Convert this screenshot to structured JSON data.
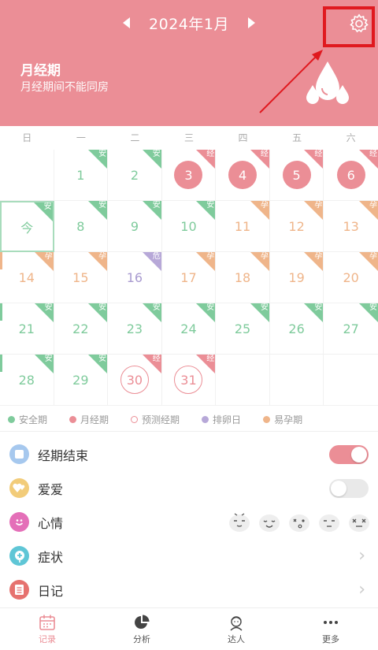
{
  "header": {
    "month_title": "2024年1月",
    "period_title": "月经期",
    "period_subtitle": "月经期间不能同房",
    "prev_icon": "triangle-left-icon",
    "next_icon": "triangle-right-icon",
    "settings_icon": "gear-icon"
  },
  "weekdays": [
    "日",
    "一",
    "二",
    "三",
    "四",
    "五",
    "六"
  ],
  "calendar": {
    "today_label": "今",
    "rows": [
      [
        {
          "d": ""
        },
        {
          "d": "1",
          "type": "safe",
          "tag": "安"
        },
        {
          "d": "2",
          "type": "safe",
          "tag": "安"
        },
        {
          "d": "3",
          "type": "period",
          "tag": "经"
        },
        {
          "d": "4",
          "type": "period",
          "tag": "经"
        },
        {
          "d": "5",
          "type": "period",
          "tag": "经"
        },
        {
          "d": "6",
          "type": "period",
          "tag": "经"
        }
      ],
      [
        {
          "d": "今",
          "type": "safe",
          "tag": "安",
          "today": true
        },
        {
          "d": "8",
          "type": "safe",
          "tag": "安"
        },
        {
          "d": "9",
          "type": "safe",
          "tag": "安"
        },
        {
          "d": "10",
          "type": "safe",
          "tag": "安"
        },
        {
          "d": "11",
          "type": "fertile",
          "tag": "孕"
        },
        {
          "d": "12",
          "type": "fertile",
          "tag": "孕"
        },
        {
          "d": "13",
          "type": "fertile",
          "tag": "孕"
        }
      ],
      [
        {
          "d": "14",
          "type": "fertile",
          "tag": "孕"
        },
        {
          "d": "15",
          "type": "fertile",
          "tag": "孕"
        },
        {
          "d": "16",
          "type": "ovu",
          "tag": "危"
        },
        {
          "d": "17",
          "type": "fertile",
          "tag": "孕"
        },
        {
          "d": "18",
          "type": "fertile",
          "tag": "孕"
        },
        {
          "d": "19",
          "type": "fertile",
          "tag": "孕"
        },
        {
          "d": "20",
          "type": "fertile",
          "tag": "孕"
        }
      ],
      [
        {
          "d": "21",
          "type": "safe",
          "tag": "安"
        },
        {
          "d": "22",
          "type": "safe",
          "tag": "安"
        },
        {
          "d": "23",
          "type": "safe",
          "tag": "安"
        },
        {
          "d": "24",
          "type": "safe",
          "tag": "安"
        },
        {
          "d": "25",
          "type": "safe",
          "tag": "安"
        },
        {
          "d": "26",
          "type": "safe",
          "tag": "安"
        },
        {
          "d": "27",
          "type": "safe",
          "tag": "安"
        }
      ],
      [
        {
          "d": "28",
          "type": "safe",
          "tag": "安"
        },
        {
          "d": "29",
          "type": "safe",
          "tag": "安"
        },
        {
          "d": "30",
          "type": "pred",
          "tag": "经"
        },
        {
          "d": "31",
          "type": "pred",
          "tag": "经"
        },
        {
          "d": ""
        },
        {
          "d": ""
        },
        {
          "d": ""
        }
      ]
    ]
  },
  "legend": [
    {
      "label": "安全期",
      "color": "#7FCB9C",
      "hollow": false
    },
    {
      "label": "月经期",
      "color": "#EB8E96",
      "hollow": false
    },
    {
      "label": "预测经期",
      "color": "#EB8E96",
      "hollow": true
    },
    {
      "label": "排卵日",
      "color": "#B7A8D8",
      "hollow": false
    },
    {
      "label": "易孕期",
      "color": "#EFB58A",
      "hollow": false
    }
  ],
  "list": {
    "period_end": {
      "label": "经期结束",
      "icon": "square-icon",
      "on": true
    },
    "love": {
      "label": "爱爱",
      "icon": "hearts-icon",
      "on": false
    },
    "mood": {
      "label": "心情",
      "icon": "smile-icon",
      "faces": [
        "mood-face-1",
        "mood-face-2",
        "mood-face-3",
        "mood-face-4",
        "mood-face-5"
      ]
    },
    "symptoms": {
      "label": "症状",
      "icon": "medical-icon"
    },
    "diary": {
      "label": "日记",
      "icon": "notebook-icon"
    }
  },
  "nav": [
    {
      "label": "记录",
      "icon": "calendar-icon",
      "active": true
    },
    {
      "label": "分析",
      "icon": "pie-chart-icon",
      "active": false
    },
    {
      "label": "达人",
      "icon": "avatar-icon",
      "active": false
    },
    {
      "label": "更多",
      "icon": "more-icon",
      "active": false
    }
  ],
  "colors": {
    "brand": "#EB8E96",
    "safe": "#7FCB9C",
    "fertile": "#EFB58A",
    "ovulation": "#B7A8D8",
    "highlight": "#E0191F"
  }
}
